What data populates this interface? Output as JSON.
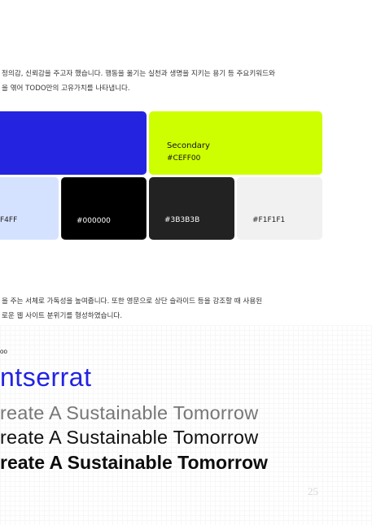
{
  "intro_paragraph": {
    "line1": "정의감, 신뢰감을 주고자 했습니다. 행동을 옮기는 실천과 생명을 지키는 용기 등 주요키워드와",
    "line2": "을 엮어 TODO만의 고유가치를 나타냅니다."
  },
  "palette": {
    "primary": {
      "label": "",
      "hex": "",
      "color": "#2424e0"
    },
    "secondary": {
      "label": "Secondary",
      "hex": "#CEFF00",
      "color": "#ceff00"
    },
    "light_blue": {
      "hex": "F4FF",
      "color": "#d5e2ff"
    },
    "black": {
      "hex": "#000000",
      "color": "#000000"
    },
    "dark_gray": {
      "hex": "#3B3B3B",
      "color": "#222222"
    },
    "light_gray": {
      "hex": "#F1F1F1",
      "color": "#f1f1f1"
    }
  },
  "font_paragraph": {
    "line1": "을 주는 서체로 가독성을 높여줍니다. 또한 영문으로 상단 슬라이드 등을 강조할 때 사용된",
    "line2": "로운 웹 사이트 분위기를 형성하였습니다."
  },
  "font_section": {
    "small_label": "oo",
    "font_name": "ntserrat",
    "sample_light": "reate A Sustainable Tomorrow",
    "sample_regular": "reate A Sustainable Tomorrow",
    "sample_bold": "reate A Sustainable Tomorrow"
  },
  "page_number": "25"
}
